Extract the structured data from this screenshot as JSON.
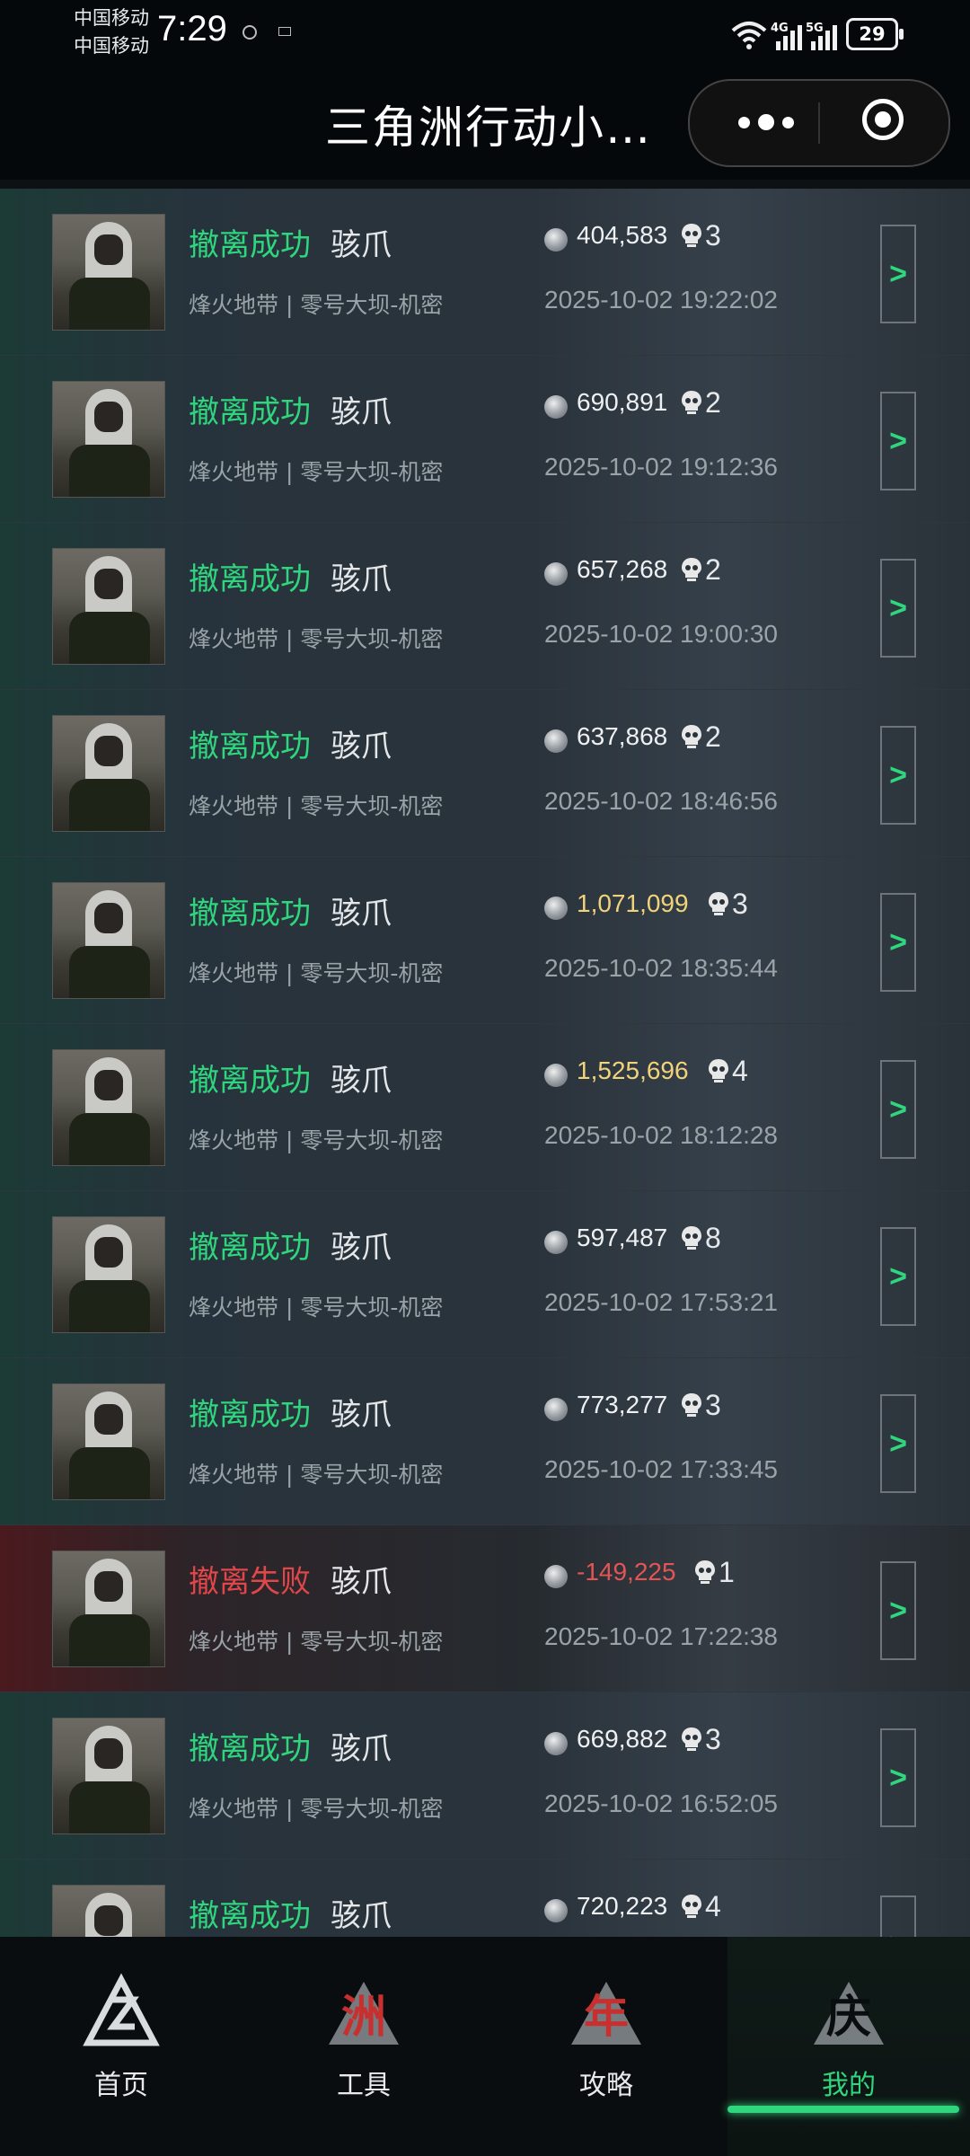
{
  "status_bar": {
    "carrier_1": "中国移动",
    "carrier_2": "中国移动",
    "time": "7:29",
    "net_1": "4G",
    "net_2": "5G",
    "battery": "29"
  },
  "title_bar": {
    "title": "三角洲行动小…",
    "more_icon": "ellipsis-icon",
    "close_icon": "target-circle-icon"
  },
  "colors": {
    "success": "#2fd67e",
    "fail": "#e0474a",
    "gold_value": "#f1d37a",
    "negative_value": "#e35555",
    "background": "#0d1114"
  },
  "records": [
    {
      "status": "撤离成功",
      "operator": "骇爪",
      "value": "404,583",
      "kills": "3",
      "mode": "烽火地带 | 零号大坝-机密",
      "time": "2025-10-02 19:22:02",
      "result": "success",
      "value_style": "normal",
      "arrow": ">"
    },
    {
      "status": "撤离成功",
      "operator": "骇爪",
      "value": "690,891",
      "kills": "2",
      "mode": "烽火地带 | 零号大坝-机密",
      "time": "2025-10-02 19:12:36",
      "result": "success",
      "value_style": "normal",
      "arrow": ">"
    },
    {
      "status": "撤离成功",
      "operator": "骇爪",
      "value": "657,268",
      "kills": "2",
      "mode": "烽火地带 | 零号大坝-机密",
      "time": "2025-10-02 19:00:30",
      "result": "success",
      "value_style": "normal",
      "arrow": ">"
    },
    {
      "status": "撤离成功",
      "operator": "骇爪",
      "value": "637,868",
      "kills": "2",
      "mode": "烽火地带 | 零号大坝-机密",
      "time": "2025-10-02 18:46:56",
      "result": "success",
      "value_style": "normal",
      "arrow": ">"
    },
    {
      "status": "撤离成功",
      "operator": "骇爪",
      "value": "1,071,099",
      "kills": "3",
      "mode": "烽火地带 | 零号大坝-机密",
      "time": "2025-10-02 18:35:44",
      "result": "success",
      "value_style": "gold",
      "arrow": ">"
    },
    {
      "status": "撤离成功",
      "operator": "骇爪",
      "value": "1,525,696",
      "kills": "4",
      "mode": "烽火地带 | 零号大坝-机密",
      "time": "2025-10-02 18:12:28",
      "result": "success",
      "value_style": "gold",
      "arrow": ">"
    },
    {
      "status": "撤离成功",
      "operator": "骇爪",
      "value": "597,487",
      "kills": "8",
      "mode": "烽火地带 | 零号大坝-机密",
      "time": "2025-10-02 17:53:21",
      "result": "success",
      "value_style": "normal",
      "arrow": ">"
    },
    {
      "status": "撤离成功",
      "operator": "骇爪",
      "value": "773,277",
      "kills": "3",
      "mode": "烽火地带 | 零号大坝-机密",
      "time": "2025-10-02 17:33:45",
      "result": "success",
      "value_style": "normal",
      "arrow": ">"
    },
    {
      "status": "撤离失败",
      "operator": "骇爪",
      "value": "-149,225",
      "kills": "1",
      "mode": "烽火地带 | 零号大坝-机密",
      "time": "2025-10-02 17:22:38",
      "result": "fail",
      "value_style": "negative",
      "arrow": ">"
    },
    {
      "status": "撤离成功",
      "operator": "骇爪",
      "value": "669,882",
      "kills": "3",
      "mode": "烽火地带 | 零号大坝-机密",
      "time": "2025-10-02 16:52:05",
      "result": "success",
      "value_style": "normal",
      "arrow": ">"
    },
    {
      "status": "撤离成功",
      "operator": "骇爪",
      "value": "720,223",
      "kills": "4",
      "mode": "",
      "time": "",
      "result": "success",
      "value_style": "normal",
      "arrow": ">"
    }
  ],
  "bottom_nav": [
    {
      "label": "首页",
      "icon": "home-logo-icon",
      "glyph": "",
      "active": false
    },
    {
      "label": "工具",
      "icon": "tools-zhou-icon",
      "glyph": "洲",
      "active": false
    },
    {
      "label": "攻略",
      "icon": "guide-nian-icon",
      "glyph": "年",
      "active": false
    },
    {
      "label": "我的",
      "icon": "profile-qing-icon",
      "glyph": "庆",
      "active": true
    }
  ]
}
